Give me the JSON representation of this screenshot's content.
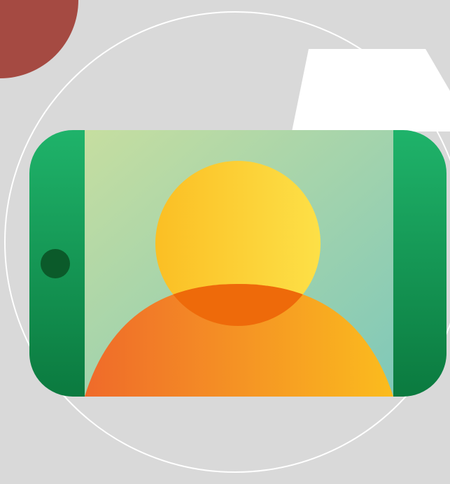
{
  "scene": {
    "background_color": "#d9d9d9",
    "accent_blob_color": "#a54a42",
    "outline_circle_color": "#ffffff",
    "white_card_color": "#ffffff",
    "icon": {
      "name": "video-selfie-icon",
      "phone_color_top": "#1fb36a",
      "phone_color_bottom": "#0b7a3f",
      "camera_dot_color": "#0b5a2a",
      "screen_gradient_start": "#c6dea0",
      "screen_gradient_end": "#7fc8b9",
      "head_gradient_start": "#fbbf24",
      "head_gradient_end": "#fde047",
      "body_gradient_start": "#ef6a2a",
      "body_gradient_end": "#fbbc1e",
      "overlap_color": "#ee6a0a"
    }
  }
}
